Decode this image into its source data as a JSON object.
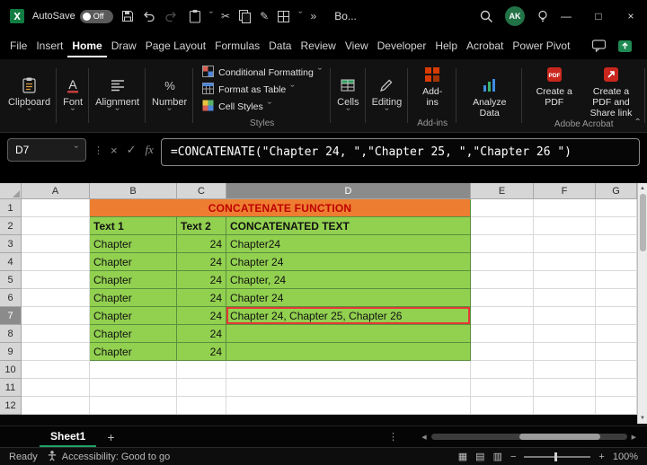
{
  "colors": {
    "excel_green": "#21A366",
    "table_green": "#92D050",
    "header_orange": "#ED7D31",
    "title_red": "#C00000",
    "selection_red": "#E53935"
  },
  "icons": {
    "chevron_down": "ˇ",
    "chevron_up": "ˆ",
    "overflow": "»",
    "ellipsis_v": "⋮",
    "scissors": "✂",
    "pencil": "✎",
    "check": "✓",
    "cancel": "×",
    "fx": "fx",
    "minimize": "—",
    "maximize": "□",
    "close": "×",
    "plus": "+",
    "left": "◀",
    "right": "▶",
    "up": "▲",
    "down": "▼",
    "view_normal": "▦",
    "view_layout": "▤",
    "view_break": "▥",
    "zoom_out": "−",
    "zoom_in": "+"
  },
  "titlebar": {
    "autosave_label": "AutoSave",
    "autosave_state": "Off",
    "doc_name": "Bo...",
    "avatar_initials": "AK"
  },
  "menubar": {
    "items": [
      "File",
      "Insert",
      "Home",
      "Draw",
      "Page Layout",
      "Formulas",
      "Data",
      "Review",
      "View",
      "Developer",
      "Help",
      "Acrobat",
      "Power Pivot"
    ],
    "active": "Home"
  },
  "ribbon": {
    "collapsed": [
      "Clipboard",
      "Font",
      "Alignment",
      "Number"
    ],
    "styles": {
      "items": [
        "Conditional Formatting",
        "Format as Table",
        "Cell Styles"
      ],
      "group_label": "Styles"
    },
    "collapsed2": [
      "Cells",
      "Editing"
    ],
    "addins": {
      "button_label": "Add-ins",
      "group_label": "Add-ins"
    },
    "analyze": {
      "button_label": "Analyze Data"
    },
    "acrobat": {
      "buttons": [
        "Create a PDF",
        "Create a PDF and Share link"
      ],
      "group_label": "Adobe Acrobat"
    }
  },
  "formula_bar": {
    "name_box": "D7",
    "formula": "=CONCATENATE(\"Chapter 24, \",\"Chapter 25, \",\"Chapter 26 \")"
  },
  "sheet": {
    "col_headers": [
      "A",
      "B",
      "C",
      "D",
      "E",
      "F",
      "G"
    ],
    "num_rows": 12,
    "selection": {
      "cell": "D7",
      "col": "D",
      "row": 7
    },
    "table": {
      "title": "CONCATENATE FUNCTION",
      "columns": [
        "Text 1",
        "Text 2",
        "CONCATENATED TEXT"
      ],
      "rows": [
        [
          "Chapter",
          "24",
          "Chapter24"
        ],
        [
          "Chapter",
          "24",
          "Chapter 24"
        ],
        [
          "Chapter",
          "24",
          "Chapter, 24"
        ],
        [
          "Chapter",
          "24",
          "Chapter 24"
        ],
        [
          "Chapter",
          "24",
          "Chapter 24, Chapter 25, Chapter 26"
        ],
        [
          "Chapter",
          "24",
          ""
        ],
        [
          "Chapter",
          "24",
          ""
        ]
      ]
    }
  },
  "sheet_tabs": {
    "active_tab": "Sheet1"
  },
  "status_bar": {
    "ready": "Ready",
    "accessibility": "Accessibility: Good to go",
    "zoom": "100%"
  }
}
